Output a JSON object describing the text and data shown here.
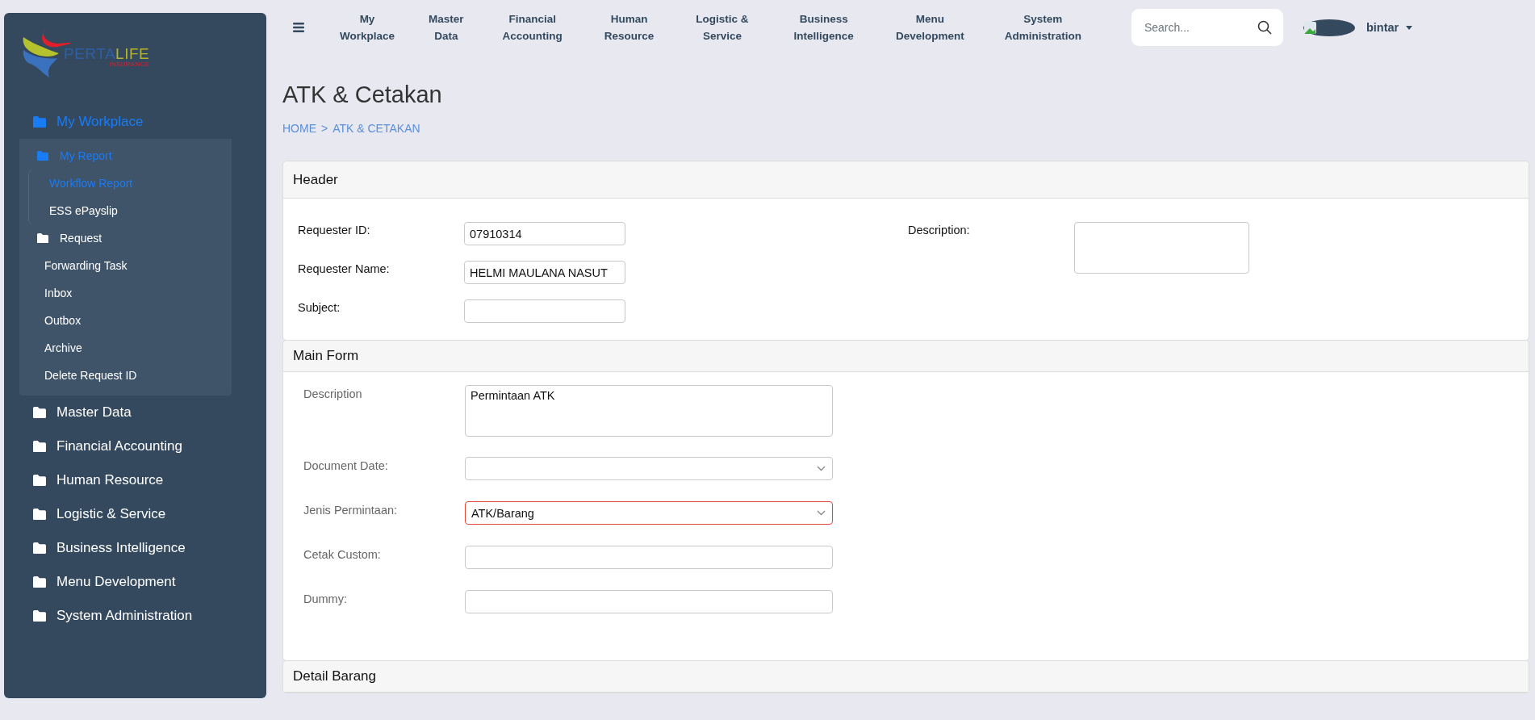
{
  "logo": {
    "wordmark": [
      "PERTA",
      "LIFE"
    ],
    "tagline": "INSURANCE"
  },
  "sidebar": {
    "items": [
      {
        "label": "My Workplace",
        "kind": "folder",
        "selected": true,
        "expanded": true,
        "children": [
          {
            "label": "My Report",
            "kind": "folder",
            "selected": true,
            "expanded": true,
            "children": [
              {
                "label": "Workflow Report",
                "kind": "link",
                "selected": true
              },
              {
                "label": "ESS ePayslip",
                "kind": "link",
                "selected": false
              }
            ]
          },
          {
            "label": "Request",
            "kind": "folder",
            "selected": false
          },
          {
            "label": "Forwarding Task",
            "kind": "link",
            "selected": false
          },
          {
            "label": "Inbox",
            "kind": "link",
            "selected": false
          },
          {
            "label": "Outbox",
            "kind": "link",
            "selected": false
          },
          {
            "label": "Archive",
            "kind": "link",
            "selected": false
          },
          {
            "label": "Delete Request ID",
            "kind": "link",
            "selected": false
          }
        ]
      },
      {
        "label": "Master Data",
        "kind": "folder",
        "selected": false
      },
      {
        "label": "Financial Accounting",
        "kind": "folder",
        "selected": false
      },
      {
        "label": "Human Resource",
        "kind": "folder",
        "selected": false
      },
      {
        "label": "Logistic & Service",
        "kind": "folder",
        "selected": false
      },
      {
        "label": "Business Intelligence",
        "kind": "folder",
        "selected": false
      },
      {
        "label": "Menu Development",
        "kind": "folder",
        "selected": false
      },
      {
        "label": "System Administration",
        "kind": "folder",
        "selected": false
      }
    ]
  },
  "topnav": {
    "items": [
      "My\nWorkplace",
      "Master\nData",
      "Financial\nAccounting",
      "Human\nResource",
      "Logistic &\nService",
      "Business\nIntelligence",
      "Menu\nDevelopment",
      "System\nAdministration"
    ],
    "search": {
      "placeholder": "Search..."
    },
    "user": {
      "name": "bintar"
    }
  },
  "page": {
    "title": "ATK & Cetakan",
    "breadcrumb": {
      "items": [
        "HOME",
        "ATK & CETAKAN"
      ],
      "separator": ">"
    }
  },
  "header_section": {
    "title": "Header",
    "left_fields": [
      {
        "label": "Requester ID:",
        "kind": "input",
        "value": "07910314"
      },
      {
        "label": "Requester Name:",
        "kind": "input",
        "value": "HELMI MAULANA NASUT"
      },
      {
        "label": "Subject:",
        "kind": "input"
      }
    ],
    "right_fields": [
      {
        "label": "Description:",
        "kind": "textarea"
      }
    ]
  },
  "main_form": {
    "title": "Main Form",
    "fields": [
      {
        "label": "Description",
        "kind": "textarea",
        "value": "Permintaan ATK",
        "invalid": false
      },
      {
        "label": "Document Date:",
        "kind": "select",
        "invalid": false
      },
      {
        "label": "Jenis Permintaan:",
        "kind": "select",
        "value": "ATK/Barang",
        "invalid": true
      },
      {
        "label": "Cetak Custom:",
        "kind": "input",
        "invalid": false
      },
      {
        "label": "Dummy:",
        "kind": "input",
        "invalid": false
      }
    ]
  },
  "detail_section": {
    "title": "Detail Barang"
  }
}
